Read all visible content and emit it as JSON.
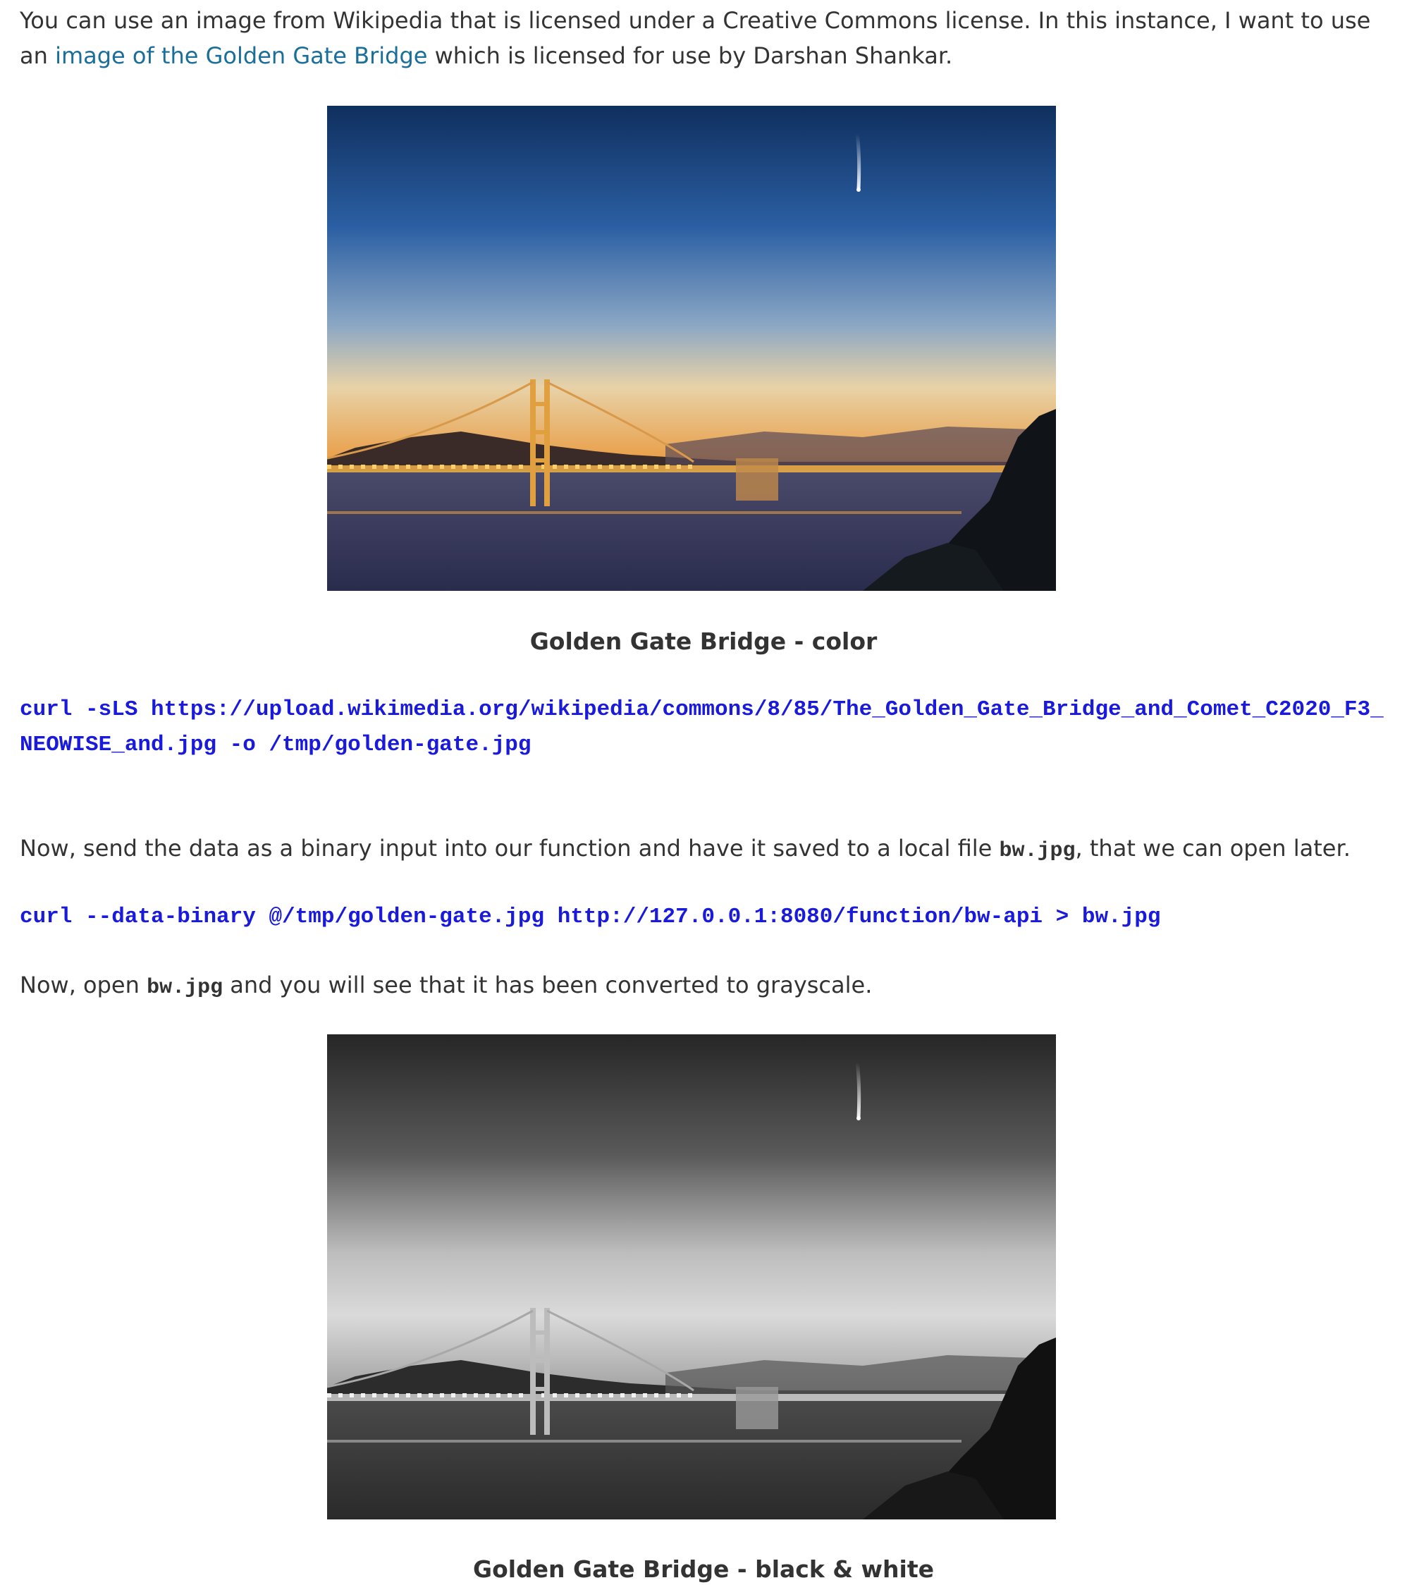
{
  "intro": {
    "before_link": "You can use an image from Wikipedia that is licensed under a Creative Commons license. In this instance, I want to use an ",
    "link_text": "image of the Golden Gate Bridge",
    "after_link": " which is licensed for use by Darshan Shankar."
  },
  "figure_color": {
    "caption": "Golden Gate Bridge - color"
  },
  "code_download": {
    "line": "curl -sLS https://upload.wikimedia.org/wikipedia/commons/8/85/The_Golden_Gate_Bridge_and_Comet_C2020_F3_NEOWISE_and.jpg -o /tmp/golden-gate.jpg"
  },
  "send_paragraph": {
    "before_code": "Now, send the data as a binary input into our function and have it saved to a local file ",
    "code": "bw.jpg",
    "after_code": ", that we can open later."
  },
  "code_send": {
    "line": "curl --data-binary @/tmp/golden-gate.jpg http://127.0.0.1:8080/function/bw-api > bw.jpg"
  },
  "open_paragraph": {
    "before_code": "Now, open ",
    "code": "bw.jpg",
    "after_code": " and you will see that it has been converted to grayscale."
  },
  "figure_bw": {
    "caption": "Golden Gate Bridge - black & white"
  },
  "colors": {
    "link": "#1a6e9a",
    "code": "#1a1adb",
    "text": "#333333"
  }
}
